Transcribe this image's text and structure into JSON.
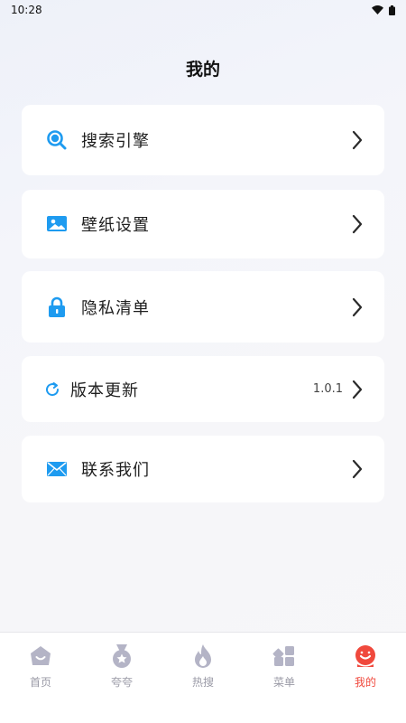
{
  "status_bar": {
    "time": "10:28"
  },
  "page": {
    "title": "我的"
  },
  "menu": [
    {
      "label": "搜索引擎",
      "icon": "search-icon",
      "value": ""
    },
    {
      "label": "壁纸设置",
      "icon": "wallpaper-image-icon",
      "value": ""
    },
    {
      "label": "隐私清单",
      "icon": "lock-icon",
      "value": ""
    },
    {
      "label": "版本更新",
      "icon": "refresh-icon",
      "value": "1.0.1"
    },
    {
      "label": "联系我们",
      "icon": "mail-icon",
      "value": ""
    }
  ],
  "tabs": [
    {
      "label": "首页",
      "icon": "home-icon",
      "active": false
    },
    {
      "label": "夸夸",
      "icon": "medal-icon",
      "active": false
    },
    {
      "label": "热搜",
      "icon": "flame-icon",
      "active": false
    },
    {
      "label": "菜单",
      "icon": "grid-menu-icon",
      "active": false
    },
    {
      "label": "我的",
      "icon": "profile-icon",
      "active": true
    }
  ],
  "colors": {
    "accent_blue": "#1e9bf0",
    "active_red": "#f0493d",
    "inactive_tab": "#9a9aa6"
  }
}
